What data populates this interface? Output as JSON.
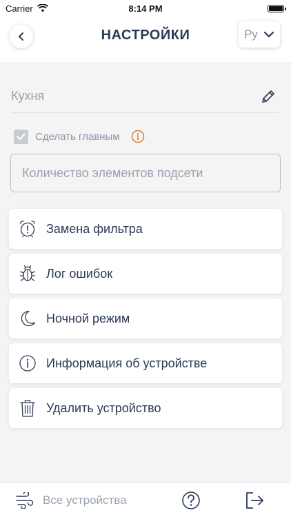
{
  "status_bar": {
    "carrier": "Carrier",
    "time": "8:14 PM"
  },
  "header": {
    "title": "НАСТРОЙКИ",
    "language": "Ру"
  },
  "device": {
    "name": "Кухня",
    "make_main_label": "Сделать главным",
    "make_main_checked": true,
    "subnet_placeholder": "Количество элементов подсети",
    "subnet_value": ""
  },
  "menu": {
    "items": [
      {
        "label": "Замена фильтра",
        "icon": "alarm-clock-icon"
      },
      {
        "label": "Лог ошибок",
        "icon": "bug-icon"
      },
      {
        "label": "Ночной режим",
        "icon": "moon-icon"
      },
      {
        "label": "Информация об устройстве",
        "icon": "info-icon"
      },
      {
        "label": "Удалить устройство",
        "icon": "trash-icon"
      }
    ]
  },
  "bottom_bar": {
    "all_devices_label": "Все устройства"
  },
  "colors": {
    "text_primary": "#2b3a55",
    "text_muted": "#9aa2b1",
    "background": "#f4f4f5",
    "info_accent": "#e07b2a"
  }
}
